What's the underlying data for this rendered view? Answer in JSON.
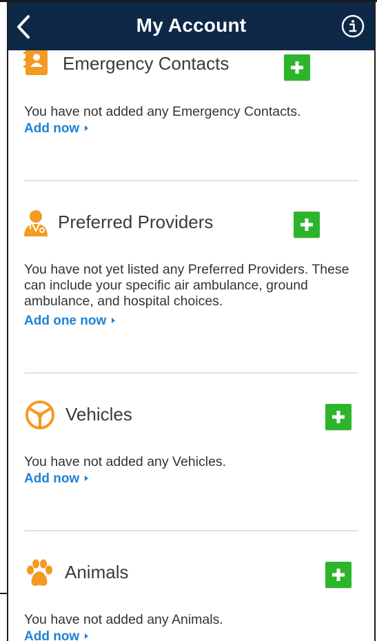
{
  "header": {
    "title": "My Account",
    "back_icon": "chevron-left-icon",
    "info_icon": "info-icon",
    "background": "#0e2847"
  },
  "colors": {
    "accent_link": "#1f82d6",
    "add_button": "#2cb52c",
    "icon_orange": "#f39a21"
  },
  "sections": [
    {
      "title": "Emergency Contacts",
      "icon": "contact-book-icon",
      "message": "You have not added any Emergency Contacts.",
      "link": "Add now"
    },
    {
      "title": "Preferred Providers",
      "icon": "doctor-icon",
      "message": "You have not yet listed any Preferred Providers. These can include your specific air ambulance, ground ambulance, and hospital choices.",
      "link": "Add one now"
    },
    {
      "title": "Vehicles",
      "icon": "steering-wheel-icon",
      "message": "You have not added any Vehicles.",
      "link": "Add now"
    },
    {
      "title": "Animals",
      "icon": "paw-icon",
      "message": "You have not added any Animals.",
      "link": "Add now"
    }
  ]
}
